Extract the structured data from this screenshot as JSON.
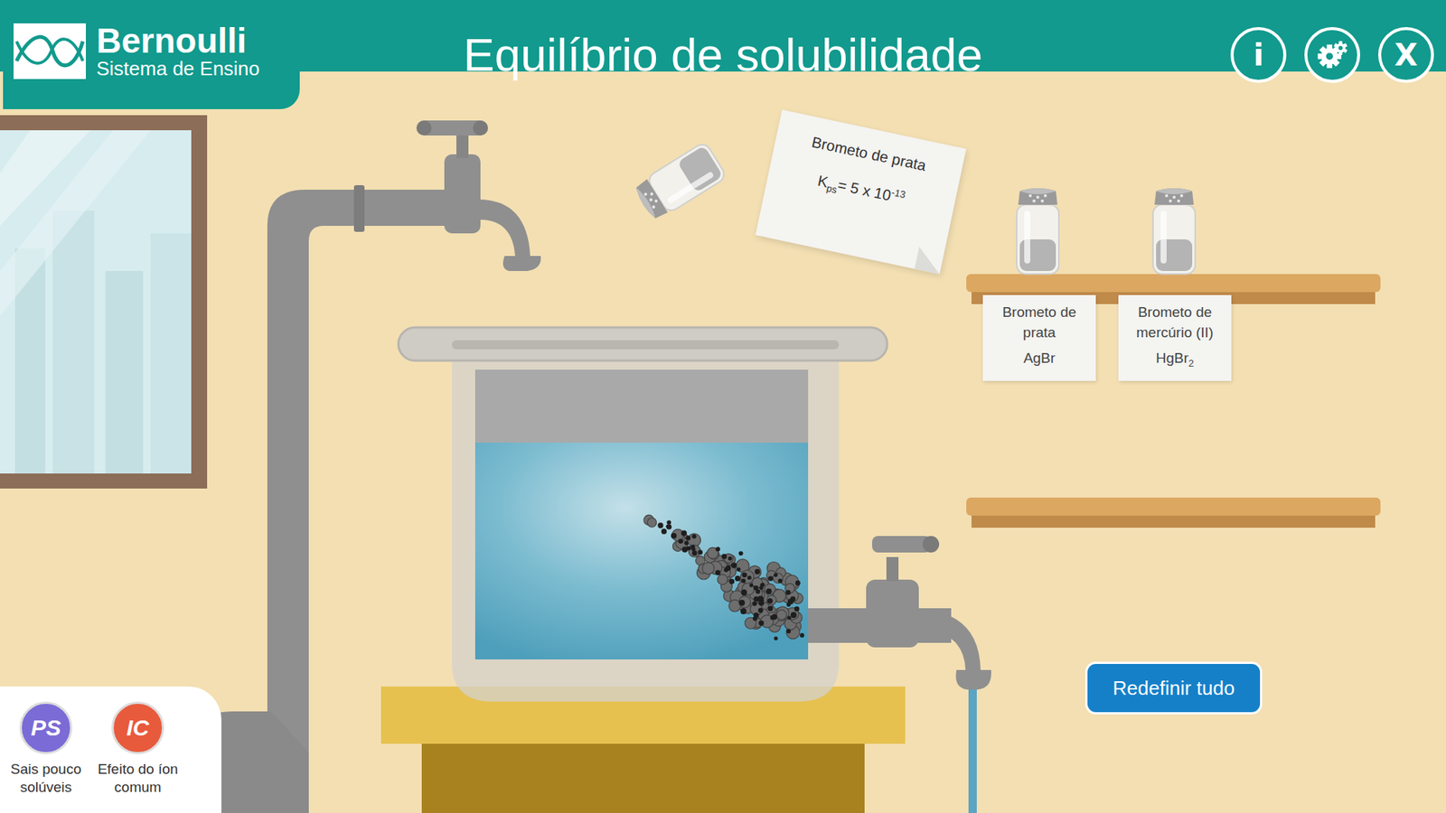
{
  "header": {
    "logo_name": "Bernoulli",
    "logo_tagline": "Sistema de Ensino",
    "title": "Equilíbrio de solubilidade",
    "buttons": [
      {
        "name": "info",
        "kind": "text",
        "label": "i"
      },
      {
        "name": "settings",
        "kind": "gear"
      },
      {
        "name": "close",
        "kind": "text",
        "label": "X"
      }
    ]
  },
  "note": {
    "title": "Brometo de prata",
    "symbol": "K",
    "symbol_sub": "ps",
    "equals": "= 5 x 10",
    "exponent": "-13"
  },
  "shelf_salts": [
    {
      "name": "Brometo de prata",
      "formula": "AgBr",
      "subscript": ""
    },
    {
      "name": "Brometo de mercúrio (II)",
      "formula": "HgBr",
      "subscript": "2"
    }
  ],
  "drain": {
    "open": true
  },
  "reset_button": "Redefinir tudo",
  "modes": [
    {
      "badge": "PS",
      "label": "Sais pouco solúveis",
      "color": "#7b6bd6"
    },
    {
      "badge": "IC",
      "label": "Efeito do íon comum",
      "color": "#e85a3c"
    }
  ]
}
